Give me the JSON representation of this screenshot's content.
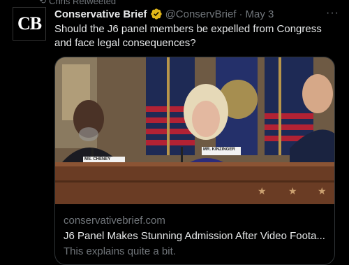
{
  "retweet": {
    "label": "Chris Retweeted"
  },
  "tweet": {
    "avatar_text": "CB",
    "author_name": "Conservative Brief",
    "handle": "@ConservBrief",
    "separator": "·",
    "date": "May 3",
    "more_label": "···",
    "text": "Should the J6 panel members be expelled from Congress and face legal consequences?"
  },
  "card": {
    "domain": "conservativebrief.com",
    "headline": "J6 Panel Makes Stunning Admission After Video Foota...",
    "description": "This explains quite a bit.",
    "nameplate_left": "MS. CHENEY",
    "nameplate_right": "MR. KINZINGER"
  },
  "colors": {
    "background": "#000000",
    "text_primary": "#e7e9ea",
    "text_secondary": "#71767b",
    "verified_badge": "#e2b719",
    "border": "#2f3336"
  },
  "icons": {
    "retweet": "retweet-icon",
    "verified": "verified-badge-icon",
    "more": "more-options-icon"
  }
}
